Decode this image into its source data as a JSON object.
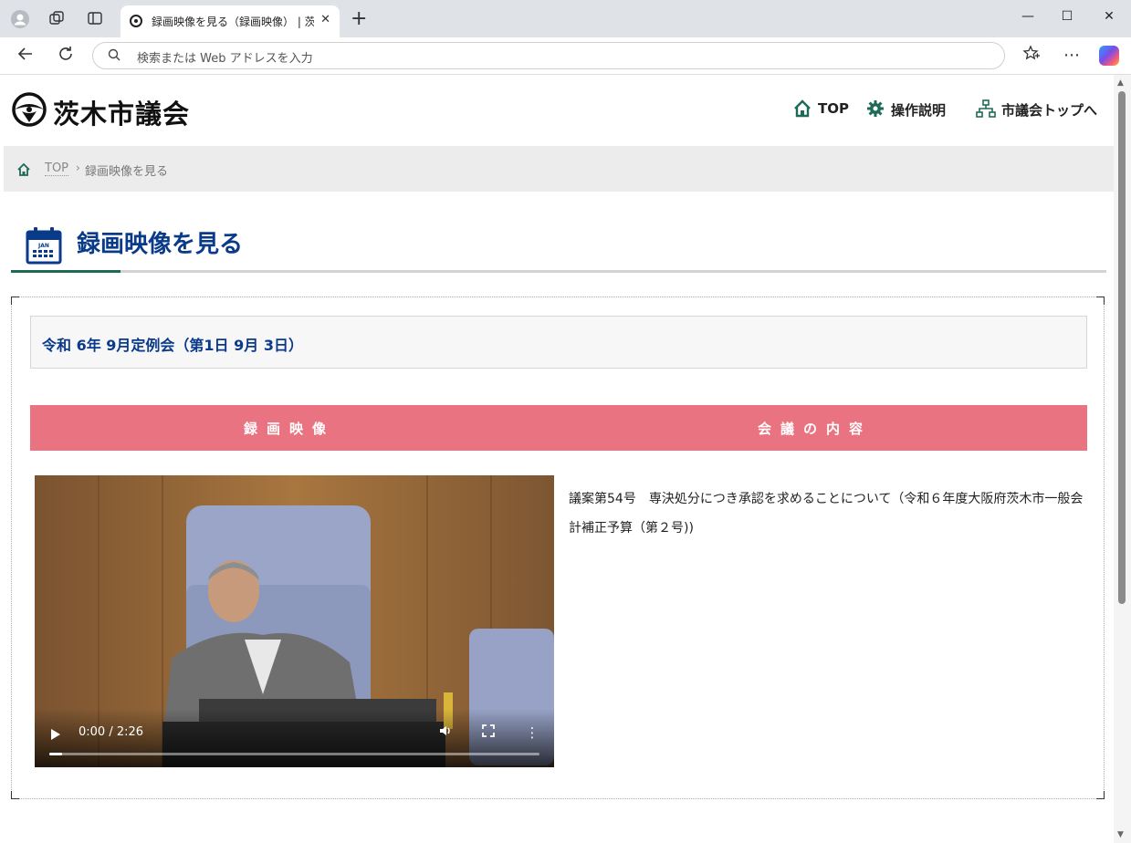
{
  "browser": {
    "tab_title": "録画映像を見る（録画映像） | 茨木市議会",
    "address_placeholder": "検索または Web アドレスを入力",
    "new_tab_glyph": "+",
    "close_glyph": "✕",
    "minimize_glyph": "—",
    "maximize_glyph": "☐"
  },
  "site": {
    "logo_text": "茨木市議会",
    "nav": [
      {
        "label": "TOP",
        "icon": "home-icon"
      },
      {
        "label": "操作説明",
        "icon": "gear-icon"
      },
      {
        "label": "市議会トップへ",
        "icon": "sitemap-icon"
      }
    ],
    "accent_color": "#1d6b57",
    "title_color": "#0a3a8a"
  },
  "breadcrumb": {
    "home": "TOP",
    "separator": "›",
    "current": "録画映像を見る"
  },
  "page": {
    "title": "録画映像を見る",
    "session": "令和 6年 9月定例会（第1日 9月 3日）",
    "header_video": "録画映像",
    "header_content": "会議の内容",
    "header_color": "#e97380"
  },
  "video": {
    "time": "0:00 / 2:26",
    "progress": 0.0
  },
  "content": {
    "text": "議案第54号　専決処分につき承認を求めることについて（令和６年度大阪府茨木市一般会計補正予算（第２号))"
  }
}
